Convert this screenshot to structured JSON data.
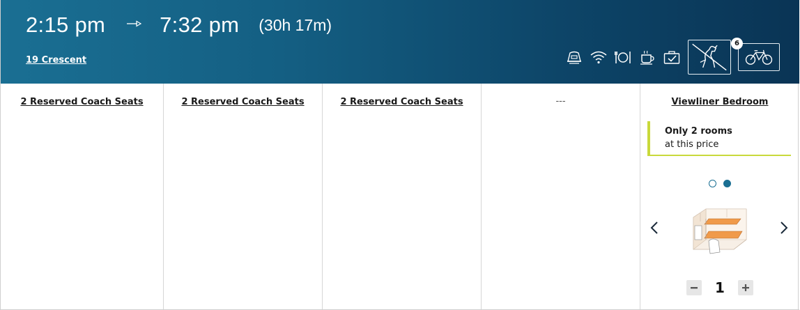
{
  "header": {
    "depart_time": "2:15 pm",
    "arrive_time": "7:32 pm",
    "duration": "(30h 17m)",
    "train_name": "19 Crescent",
    "amenities": [
      "cafe-car-icon",
      "wifi-icon",
      "dining-icon",
      "coffee-icon",
      "checked-baggage-icon",
      "no-pets-icon",
      "bicycle-icon"
    ],
    "bike_count": "6"
  },
  "columns": [
    {
      "title": "2 Reserved Coach Seats"
    },
    {
      "title": "2 Reserved Coach Seats"
    },
    {
      "title": "2 Reserved Coach Seats"
    },
    {
      "title": "---"
    },
    {
      "title": "Viewliner Bedroom",
      "alert_line1": "Only 2 rooms",
      "alert_line2": "at this price",
      "carousel_pages": 2,
      "carousel_active": 2,
      "quantity": "1"
    }
  ],
  "colors": {
    "header_start": "#1a6f93",
    "header_end": "#0a3455",
    "alert_accent": "#c9d93b",
    "dot_accent": "#1a6f93"
  }
}
